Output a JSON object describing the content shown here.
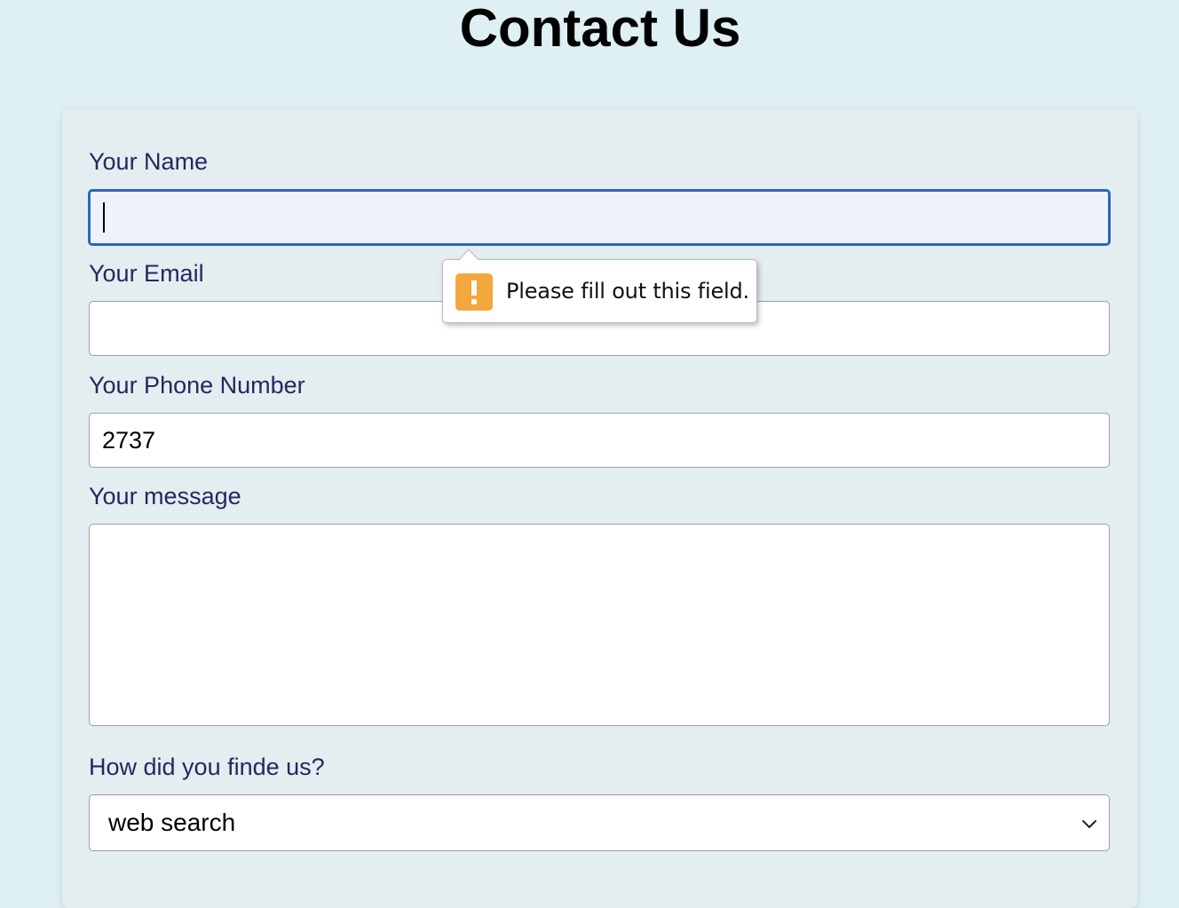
{
  "page": {
    "title": "Contact Us"
  },
  "form": {
    "name": {
      "label": "Your Name",
      "value": ""
    },
    "email": {
      "label": "Your Email",
      "value": ""
    },
    "phone": {
      "label": "Your Phone Number",
      "value": "2737"
    },
    "message": {
      "label": "Your message",
      "value": ""
    },
    "source": {
      "label": "How did you finde us?",
      "selected": "web search"
    }
  },
  "validation": {
    "message": "Please fill out this field.",
    "icon": "warning-icon",
    "icon_color": "#f4a73c"
  },
  "colors": {
    "background": "#def0f3",
    "card": "#e4edf0",
    "label": "#25285f",
    "focus_border": "#2c63c2"
  }
}
